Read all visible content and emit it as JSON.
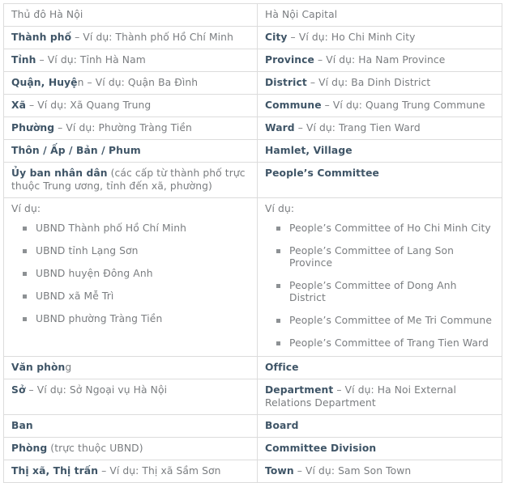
{
  "table": {
    "rows": [
      {
        "id": "capital",
        "left": {
          "term": "",
          "rest": "Thủ đô Hà Nội",
          "plain": true
        },
        "right": {
          "term": "",
          "rest": "Hà Nội Capital",
          "plain": true
        }
      },
      {
        "id": "city",
        "left": {
          "term": "Thành phố",
          "rest": " – Ví dụ: Thành phố Hồ Chí Minh"
        },
        "right": {
          "term": "City",
          "rest": " – Ví dụ: Ho Chi Minh City"
        }
      },
      {
        "id": "province",
        "left": {
          "term": "Tỉnh",
          "rest": " – Ví dụ: Tỉnh Hà Nam"
        },
        "right": {
          "term": "Province",
          "rest": " – Ví dụ: Ha Nam Province"
        }
      },
      {
        "id": "district",
        "left": {
          "term": "Quận, Huyệ",
          "rest": "n – Ví dụ: Quận Ba Đình"
        },
        "right": {
          "term": "District",
          "rest": " – Ví dụ: Ba Dinh District"
        }
      },
      {
        "id": "commune",
        "left": {
          "term": "Xã",
          "rest": " – Ví dụ: Xã Quang Trung"
        },
        "right": {
          "term": "Commune",
          "rest": " – Ví dụ: Quang Trung Commune"
        }
      },
      {
        "id": "ward",
        "left": {
          "term": "Phường",
          "rest": " – Ví dụ: Phường Tràng Tiền"
        },
        "right": {
          "term": "Ward",
          "rest": " – Ví dụ: Trang Tien Ward"
        }
      },
      {
        "id": "hamlet",
        "left": {
          "term": "Thôn / Ấp / Bản / Phum",
          "rest": ""
        },
        "right": {
          "term": "Hamlet, Village",
          "rest": ""
        }
      },
      {
        "id": "peoples-committee",
        "tall": true,
        "left": {
          "term": "Ủy ban nhân dân",
          "rest": " (các cấp từ thành phố trực thuộc Trung ương, tỉnh đến xã, phường)"
        },
        "right": {
          "term": "People’s Committee",
          "rest": ""
        }
      }
    ],
    "examples_row": {
      "id": "examples",
      "left": {
        "label": "Ví dụ:",
        "items": [
          "UBND Thành phố Hồ Chí Minh",
          "UBND tỉnh Lạng Sơn",
          "UBND huyện Đông Anh",
          "UBND xã Mễ Trì",
          "UBND phường Tràng Tiền"
        ]
      },
      "right": {
        "label": "Ví dụ:",
        "items": [
          "People’s Committee of Ho Chi Minh City",
          "People’s Committee of Lang Son Province",
          "People’s Committee of Dong Anh District",
          "People’s Committee of Me Tri Commune",
          "People’s Committee of Trang Tien Ward"
        ]
      }
    },
    "rows_bottom": [
      {
        "id": "office",
        "left": {
          "term": "Văn phòn",
          "rest": "g"
        },
        "right": {
          "term": "Office",
          "rest": ""
        }
      },
      {
        "id": "department",
        "tall": true,
        "left": {
          "term": "Sở",
          "rest": " – Ví dụ: Sở Ngoại vụ Hà Nội"
        },
        "right": {
          "term": "Department",
          "rest": " – Ví dụ: Ha Noi External Relations Department"
        }
      },
      {
        "id": "board",
        "left": {
          "term": "Ban",
          "rest": ""
        },
        "right": {
          "term": "Board",
          "rest": ""
        }
      },
      {
        "id": "committee-division",
        "left": {
          "term": "Phòng",
          "rest": " (trực thuộc UBND)"
        },
        "right": {
          "term": "Committee Division",
          "rest": ""
        }
      },
      {
        "id": "town",
        "left": {
          "term": "Thị xã, Thị trấn",
          "rest": " – Ví dụ: Thị xã Sầm Sơn"
        },
        "right": {
          "term": "Town",
          "rest": " – Ví dụ: Sam Son Town"
        }
      }
    ]
  },
  "colors": {
    "term": "#3f5567",
    "body_text": "#7a7d80",
    "border": "#dcdcdc",
    "bullet": "#8d9194",
    "background": "#ffffff"
  }
}
